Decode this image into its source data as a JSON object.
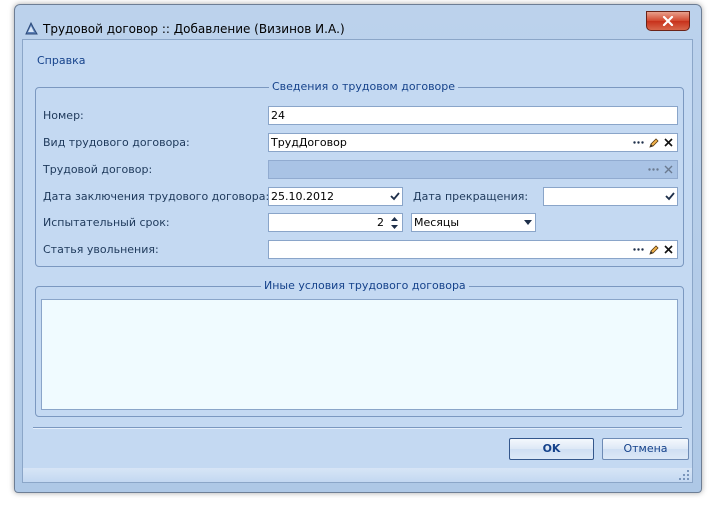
{
  "window": {
    "title": "Трудовой договор :: Добавление  (Визинов И.А.)"
  },
  "menu": {
    "help": "Справка"
  },
  "contract_group": {
    "legend": "Сведения о трудовом договоре",
    "number_label": "Номер:",
    "number_value": "24",
    "type_label": "Вид трудового договора:",
    "type_value": "ТрудДоговор",
    "contract_label": "Трудовой договор:",
    "contract_value": "",
    "date_label": "Дата заключения трудового договора:",
    "date_value": "25.10.2012",
    "end_date_label": "Дата прекращения:",
    "end_date_value": "",
    "probation_label": "Испытательный срок:",
    "probation_value": "2",
    "probation_unit": "Месяцы",
    "dismissal_label": "Статья увольнения:",
    "dismissal_value": ""
  },
  "other_group": {
    "legend": "Иные условия трудового договора",
    "value": ""
  },
  "buttons": {
    "ok": "OK",
    "cancel": "Отмена"
  },
  "colors": {
    "window_bg": "#c4d9f2",
    "accent_text": "#15428b",
    "close_red": "#c7311b"
  }
}
